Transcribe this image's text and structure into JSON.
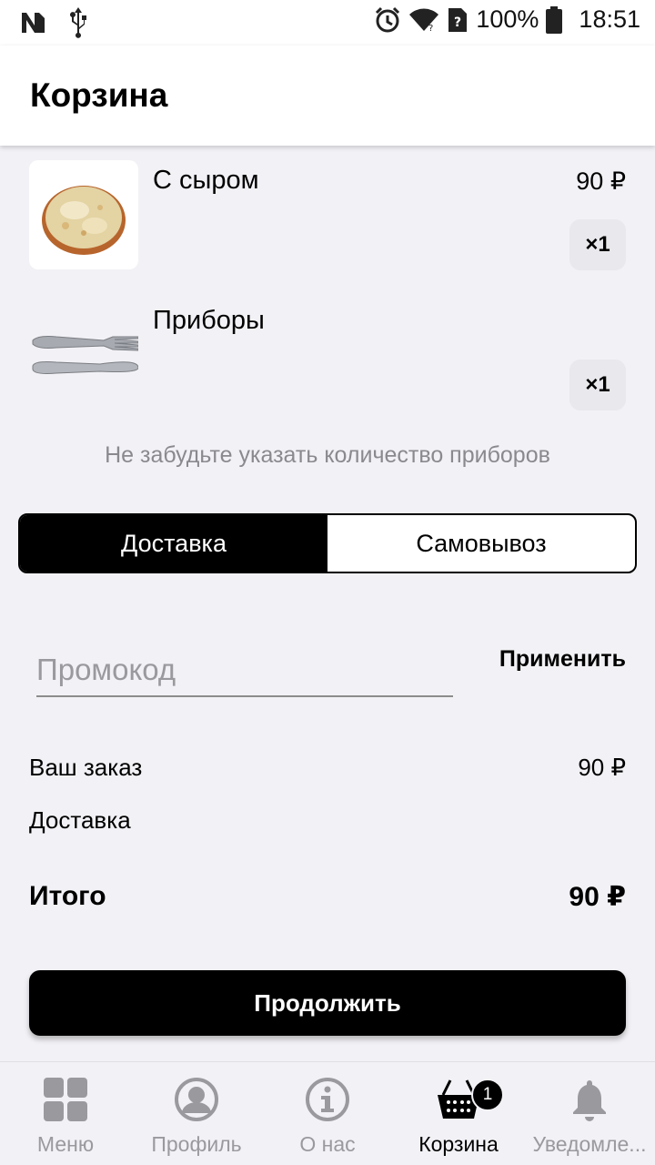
{
  "status_bar": {
    "battery": "100%",
    "time": "18:51"
  },
  "header": {
    "title": "Корзина"
  },
  "cart": {
    "items": [
      {
        "name": "С сыром",
        "price": "90 ₽",
        "qty": "×1",
        "image": "pizza"
      },
      {
        "name": "Приборы",
        "price": "",
        "qty": "×1",
        "image": "cutlery"
      }
    ],
    "hint": "Не забудьте указать количество приборов"
  },
  "delivery_toggle": {
    "options": [
      "Доставка",
      "Самовывоз"
    ],
    "selected": "Доставка"
  },
  "promo": {
    "placeholder": "Промокод",
    "value": "",
    "apply_label": "Применить"
  },
  "summary": {
    "order_label": "Ваш заказ",
    "order_value": "90 ₽",
    "delivery_label": "Доставка",
    "delivery_value": "",
    "total_label": "Итого",
    "total_value": "90 ₽"
  },
  "continue_label": "Продолжить",
  "bottom_nav": {
    "items": [
      {
        "label": "Меню",
        "icon": "grid-icon"
      },
      {
        "label": "Профиль",
        "icon": "profile-icon"
      },
      {
        "label": "О нас",
        "icon": "info-icon"
      },
      {
        "label": "Корзина",
        "icon": "basket-icon",
        "badge": "1",
        "active": true
      },
      {
        "label": "Уведомле...",
        "icon": "bell-icon"
      }
    ]
  }
}
